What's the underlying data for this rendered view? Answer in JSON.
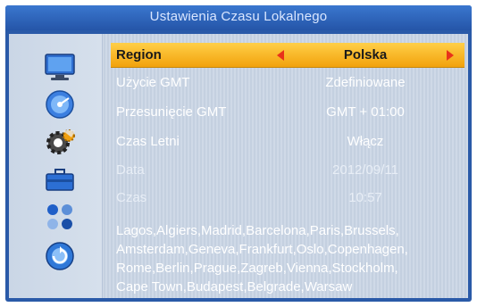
{
  "window": {
    "title": "Ustawienia Czasu Lokalnego"
  },
  "sidebar": {
    "icons": [
      "tv-icon",
      "disc-icon",
      "gear-icon",
      "toolbox-icon",
      "apps-icon",
      "power-disc-icon"
    ]
  },
  "settings": {
    "region": {
      "label": "Region",
      "value": "Polska"
    },
    "gmt_usage": {
      "label": "Użycie GMT",
      "value": "Zdefiniowane"
    },
    "gmt_offset": {
      "label": "Przesunięcie GMT",
      "value": "GMT + 01:00"
    },
    "summer_time": {
      "label": "Czas Letni",
      "value": "Włącz"
    },
    "date": {
      "label": "Data",
      "value": "2012/09/11"
    },
    "time": {
      "label": "Czas",
      "value": "10:57"
    }
  },
  "cities": {
    "line1": "Lagos,Algiers,Madrid,Barcelona,Paris,Brussels,",
    "line2": "Amsterdam,Geneva,Frankfurt,Oslo,Copenhagen,",
    "line3": "Rome,Berlin,Prague,Zagreb,Vienna,Stockholm,",
    "line4": "Cape Town,Budapest,Belgrade,Warsaw"
  },
  "colors": {
    "frame": "#2a5aa8",
    "highlight": "#f5b020",
    "arrow": "#e8321a"
  }
}
